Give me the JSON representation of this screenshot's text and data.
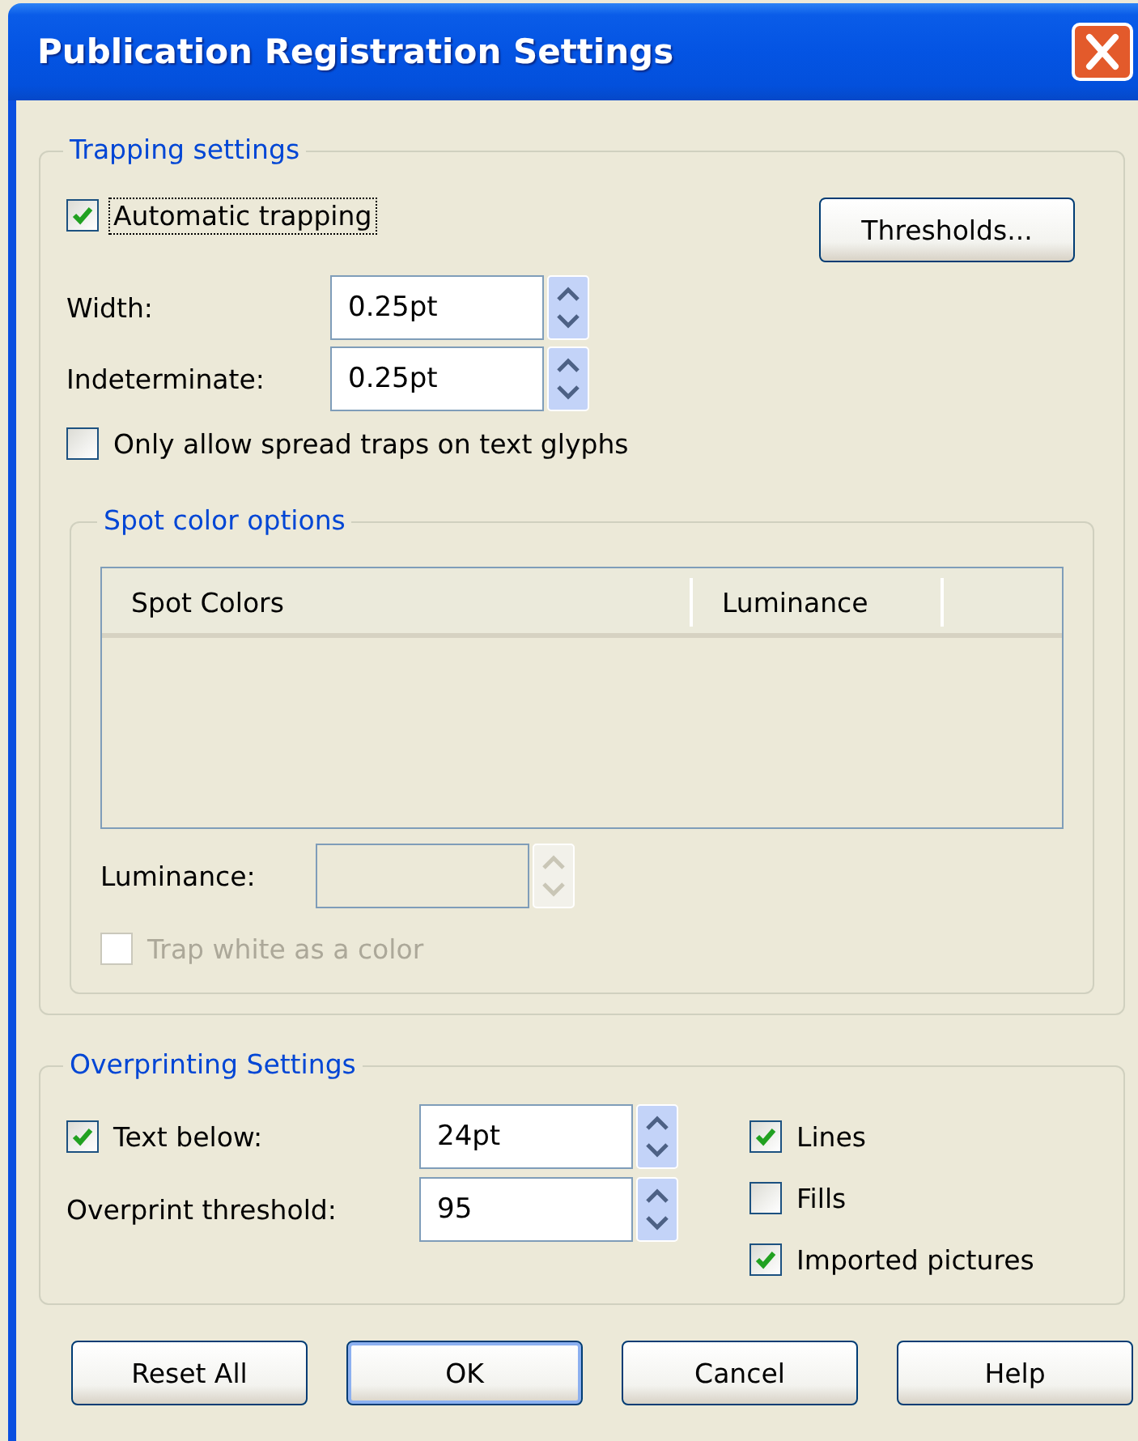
{
  "window": {
    "title": "Publication Registration Settings"
  },
  "trapping": {
    "legend": "Trapping settings",
    "automatic_trapping": {
      "label": "Automatic trapping",
      "checked": true,
      "focused": true
    },
    "thresholds_button": "Thresholds...",
    "fields": [
      {
        "label": "Width:",
        "value": "0.25pt"
      },
      {
        "label": "Indeterminate:",
        "value": "0.25pt"
      }
    ],
    "spread_traps": {
      "label": "Only allow spread traps on text glyphs",
      "checked": false
    },
    "spot_color_options": {
      "legend": "Spot color options",
      "columns": [
        "Spot Colors",
        "Luminance"
      ],
      "luminance": {
        "label": "Luminance:",
        "disabled": true
      },
      "trap_white": {
        "label": "Trap white as a color",
        "checked": false,
        "disabled": true
      }
    }
  },
  "overprinting": {
    "legend": "Overprinting Settings",
    "text_below": {
      "label": "Text below:",
      "checked": true,
      "value": "24pt"
    },
    "threshold": {
      "label": "Overprint threshold:",
      "value": "95"
    },
    "options": [
      {
        "label": "Lines",
        "checked": true
      },
      {
        "label": "Fills",
        "checked": false
      },
      {
        "label": "Imported pictures",
        "checked": true
      }
    ]
  },
  "buttons": [
    {
      "label": "Reset All",
      "default": false
    },
    {
      "label": "OK",
      "default": true
    },
    {
      "label": "Cancel",
      "default": false
    },
    {
      "label": "Help",
      "default": false
    }
  ]
}
